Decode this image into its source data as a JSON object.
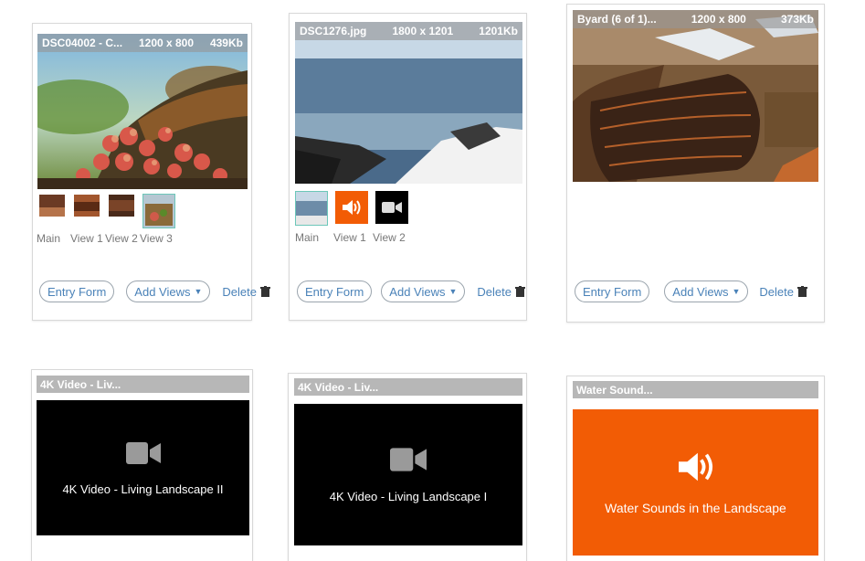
{
  "cards": [
    {
      "file": "DSC04002 - C...",
      "dimensions": "1200 x 800",
      "size": "439Kb",
      "thumb_labels": [
        "Main",
        "View 1",
        "View 2",
        "View 3"
      ],
      "entry_form": "Entry Form",
      "add_views": "Add Views",
      "delete": "Delete"
    },
    {
      "file": "DSC1276.jpg",
      "dimensions": "1800 x 1201",
      "size": "1201Kb",
      "thumb_labels": [
        "Main",
        "View 1",
        "View 2"
      ],
      "entry_form": "Entry Form",
      "add_views": "Add Views",
      "delete": "Delete"
    },
    {
      "file": "Byard (6 of 1)...",
      "dimensions": "1200 x 800",
      "size": "373Kb",
      "entry_form": "Entry Form",
      "add_views": "Add Views",
      "delete": "Delete"
    }
  ],
  "media": [
    {
      "title": "4K Video - Liv...",
      "caption": "4K Video - Living Landscape II",
      "type": "video"
    },
    {
      "title": "4K Video - Liv...",
      "caption": "4K Video - Living Landscape I",
      "type": "video"
    },
    {
      "title": "Water Sound...",
      "caption": "Water Sounds in the Landscape",
      "type": "audio"
    }
  ],
  "colors": {
    "link": "#4a82b8",
    "audio_orange": "#f25c05",
    "selected_border": "#6cc7b9",
    "video_black": "#000000"
  },
  "icons": {
    "audio": "speaker-icon",
    "video": "video-camera-icon",
    "delete": "trash-icon",
    "dropdown": "caret-down-icon"
  }
}
